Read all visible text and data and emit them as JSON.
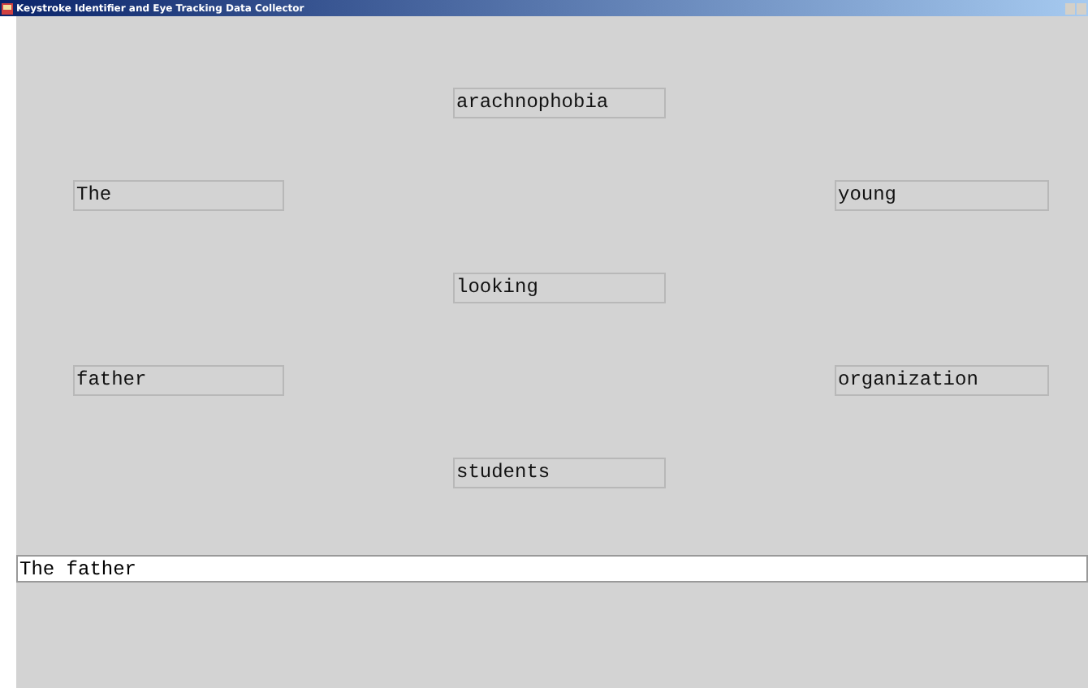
{
  "window": {
    "title": "Keystroke Identifier and Eye Tracking Data Collector"
  },
  "rows": [
    {
      "center": "arachnophobia"
    },
    {
      "left": "The",
      "right": "young"
    },
    {
      "center": "looking"
    },
    {
      "left": "father",
      "right": "organization"
    },
    {
      "center": "students"
    }
  ],
  "input": {
    "value": "The father"
  }
}
